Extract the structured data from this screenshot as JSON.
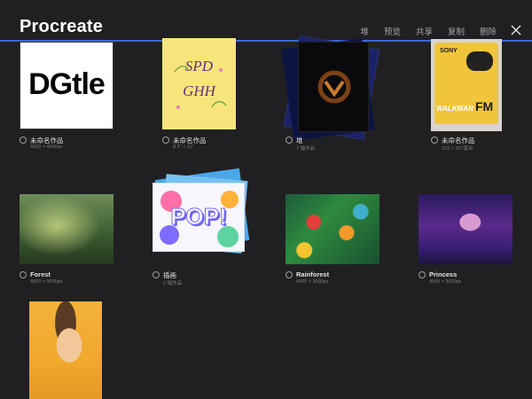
{
  "app": {
    "title": "Procreate",
    "actions": [
      "堆",
      "预览",
      "共享",
      "复制",
      "删除"
    ],
    "close_icon": "close-icon"
  },
  "gallery": [
    {
      "title": "未命名作品",
      "subtitle": "4000 × 4000px",
      "art": {
        "kind": "logo",
        "text": "DGtle"
      }
    },
    {
      "title": "未命名作品",
      "subtitle": "8.5\" × 11\"",
      "art": {
        "kind": "lettering",
        "lines": [
          "SPD",
          "GHH"
        ]
      }
    },
    {
      "title": "堆",
      "subtitle": "7 幅作品",
      "art": {
        "kind": "stack",
        "emblem": "overwatch-logo"
      }
    },
    {
      "title": "未命名作品",
      "subtitle": "210 × 297毫米",
      "art": {
        "kind": "walkman",
        "brand": "SONY",
        "model": "WALKMAN",
        "band": "FM"
      }
    },
    {
      "title": "Forest",
      "subtitle": "4000 × 3000px",
      "art": {
        "kind": "painting",
        "theme": "forest"
      }
    },
    {
      "title": "插画",
      "subtitle": "2 幅作品",
      "art": {
        "kind": "stack",
        "text": "POP!"
      }
    },
    {
      "title": "Rainforest",
      "subtitle": "4000 × 3000px",
      "art": {
        "kind": "painting",
        "theme": "rainforest"
      }
    },
    {
      "title": "Princess",
      "subtitle": "4000 × 3000px",
      "art": {
        "kind": "painting",
        "theme": "cyberpunk"
      }
    },
    {
      "title": "",
      "subtitle": "",
      "art": {
        "kind": "painting",
        "theme": "portrait"
      }
    }
  ],
  "colors": {
    "background": "#202022",
    "accent_line": "#3a67d6"
  }
}
